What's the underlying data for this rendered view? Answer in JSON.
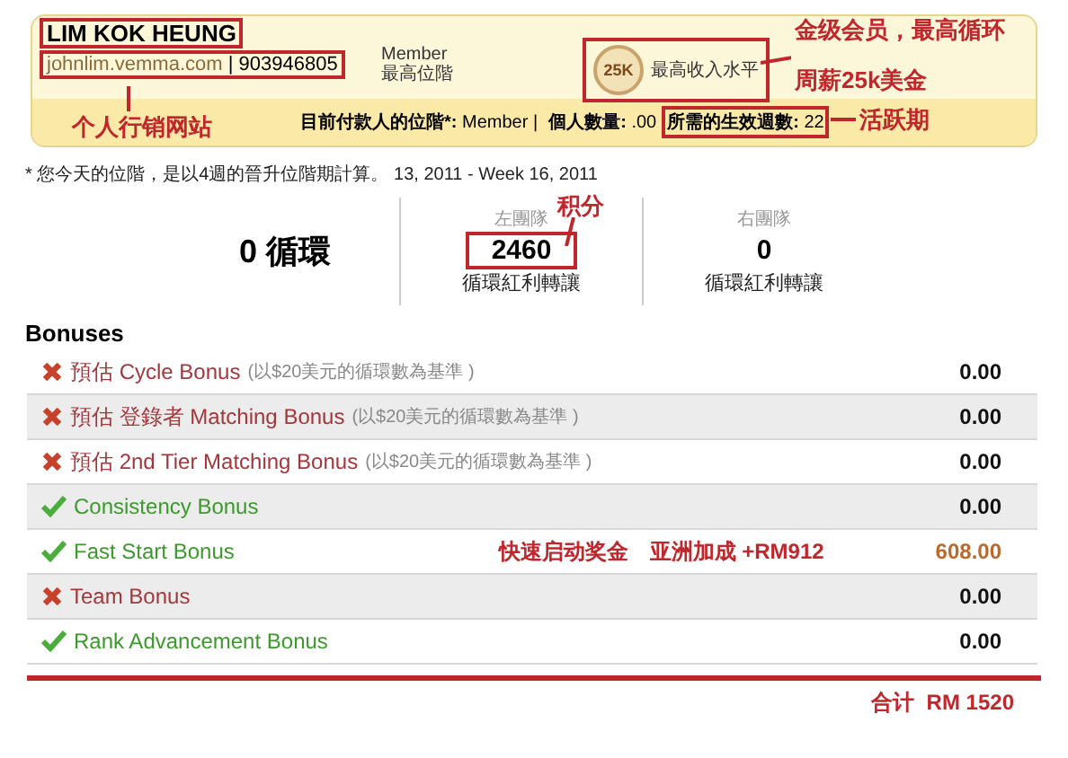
{
  "account": {
    "name": "LIM KOK HEUNG",
    "site": "johnlim.vemma.com",
    "id": "| 903946805",
    "rank": "Member",
    "rank_label": "最高位階",
    "badge": "25K",
    "badge_label": "最高收入水平"
  },
  "status": [
    {
      "label": "目前付款人的位階*:",
      "value": "Member |",
      "boxed": false
    },
    {
      "label": "個人數量:",
      "value": ".00",
      "boxed": false
    },
    {
      "label": "所需的生效週數:",
      "value": "22",
      "boxed": true
    }
  ],
  "note": "* 您今天的位階，是以4週的晉升位階期計算。 13, 2011 - Week 16, 2011",
  "cycles": "0 循環",
  "teams": [
    {
      "title": "左團隊",
      "value": "2460",
      "caption": "循環紅利轉讓",
      "boxed": true
    },
    {
      "title": "右團隊",
      "value": "0",
      "caption": "循環紅利轉讓",
      "boxed": false
    }
  ],
  "bonuses_title": "Bonuses",
  "bonuses": [
    {
      "kind": "cross",
      "name": "預估 Cycle Bonus",
      "basis": "(以$20美元的循環數為基準 )",
      "amount": "0.00",
      "paid": false
    },
    {
      "kind": "cross",
      "name": "預估 登錄者 Matching Bonus",
      "basis": "(以$20美元的循環數為基準 )",
      "amount": "0.00",
      "paid": false
    },
    {
      "kind": "cross",
      "name": "預估 2nd Tier Matching Bonus",
      "basis": "(以$20美元的循環數為基準 )",
      "amount": "0.00",
      "paid": false
    },
    {
      "kind": "check",
      "name": "Consistency Bonus",
      "amount": "0.00",
      "paid": false
    },
    {
      "kind": "check",
      "name": "Fast Start Bonus",
      "remark": "快速启动奖金　亚洲加成  +RM912",
      "amount": "608.00",
      "paid": true
    },
    {
      "kind": "cross",
      "name": "Team Bonus",
      "amount": "0.00",
      "paid": false
    },
    {
      "kind": "check",
      "name": "Rank Advancement Bonus",
      "amount": "0.00",
      "paid": false
    }
  ],
  "annotations": {
    "gold": "金级会员，最高循环",
    "weekly": "周薪25k美金",
    "site": "个人行销网站",
    "active": "活跃期",
    "points": "积分"
  },
  "total": "合计  RM 1520"
}
